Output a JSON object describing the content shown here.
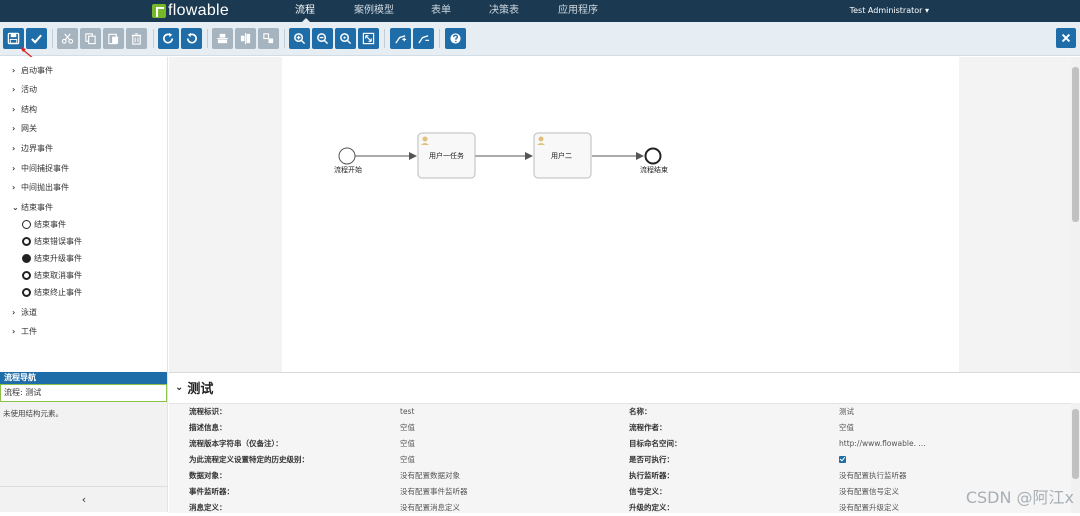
{
  "app": {
    "logo": "flowable"
  },
  "nav": [
    "流程",
    "案例模型",
    "表单",
    "决策表",
    "应用程序"
  ],
  "user": "Test Administrator ▾",
  "palette": {
    "groups": [
      "启动事件",
      "活动",
      "结构",
      "网关",
      "边界事件",
      "中间捕捉事件",
      "中间抛出事件",
      "结束事件"
    ],
    "end_events": [
      "结束事件",
      "结束错误事件",
      "结束升级事件",
      "结束取消事件",
      "结束终止事件"
    ],
    "after": [
      "泳道",
      "工件"
    ]
  },
  "diagram": {
    "start_label": "流程开始",
    "task1": "用户一任务",
    "task2": "用户二",
    "end_label": "流程结束"
  },
  "navigator": {
    "title": "流程导航",
    "process": "流程: 测试",
    "empty": "未使用结构元素。"
  },
  "props": {
    "title": "测试",
    "rows": [
      {
        "l1": "流程标识：",
        "v1": "test",
        "l2": "名称：",
        "v2": "测试"
      },
      {
        "l1": "描述信息：",
        "v1": "空值",
        "l2": "流程作者：",
        "v2": "空值"
      },
      {
        "l1": "流程版本字符串（仅备注）：",
        "v1": "空值",
        "l2": "目标命名空间：",
        "v2": "http://www.flowable. ..."
      },
      {
        "l1": "为此流程定义设置特定的历史级别：",
        "v1": "空值",
        "l2": "是否可执行：",
        "v2": ""
      },
      {
        "l1": "数据对象：",
        "v1": "没有配置数据对象",
        "l2": "执行监听器：",
        "v2": "没有配置执行监听器"
      },
      {
        "l1": "事件监听器：",
        "v1": "没有配置事件监听器",
        "l2": "信号定义：",
        "v2": "没有配置信号定义"
      },
      {
        "l1": "消息定义：",
        "v1": "没有配置消息定义",
        "l2": "升级的定义：",
        "v2": "没有配置升级定义"
      }
    ]
  },
  "watermark": "CSDN @阿江x"
}
